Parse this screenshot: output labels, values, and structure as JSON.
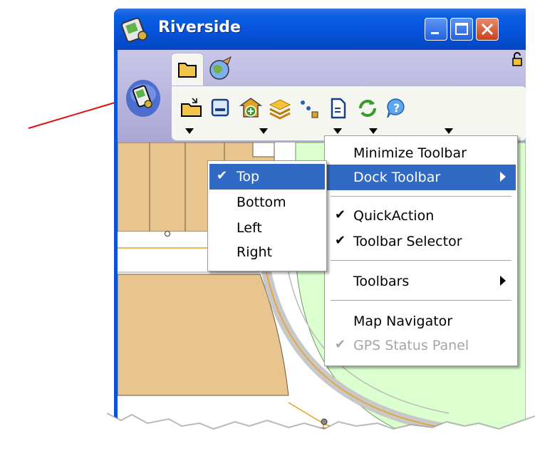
{
  "window": {
    "title": "Riverside"
  },
  "toolbar": {
    "tabs": [
      {
        "name": "folder-tab",
        "icon": "folder-icon"
      },
      {
        "name": "globe-tab",
        "icon": "globe-icon"
      }
    ],
    "tools": [
      {
        "icon": "open-folder-icon",
        "has_dropdown": true
      },
      {
        "icon": "save-icon",
        "has_dropdown": false
      },
      {
        "icon": "add-layer-icon",
        "has_dropdown": true
      },
      {
        "icon": "layers-icon",
        "has_dropdown": false
      },
      {
        "icon": "measure-icon",
        "has_dropdown": true
      },
      {
        "icon": "document-icon",
        "has_dropdown": true
      },
      {
        "icon": "refresh-icon",
        "has_dropdown": false
      },
      {
        "icon": "help-icon",
        "has_dropdown": true
      }
    ]
  },
  "context_menu": {
    "items": [
      {
        "label": "Minimize Toolbar"
      },
      {
        "label": "Dock Toolbar",
        "has_submenu": true,
        "highlighted": true
      },
      {
        "label": "QuickAction",
        "checked": true
      },
      {
        "label": "Toolbar Selector",
        "checked": true
      },
      {
        "label": "Toolbars",
        "has_submenu": true
      },
      {
        "label": "Map Navigator"
      },
      {
        "label": "GPS Status Panel",
        "checked": true,
        "disabled": true
      }
    ]
  },
  "dock_submenu": {
    "items": [
      {
        "label": "Top",
        "checked": true,
        "highlighted": true
      },
      {
        "label": "Bottom"
      },
      {
        "label": "Left"
      },
      {
        "label": "Right"
      }
    ]
  },
  "colors": {
    "titlebar": "#0651d8",
    "menu_highlight": "#316ac5",
    "parcel": "#e8c48e",
    "park": "#dcffd0",
    "road_line": "#e8a020",
    "pointer_arrow": "#e01010"
  }
}
